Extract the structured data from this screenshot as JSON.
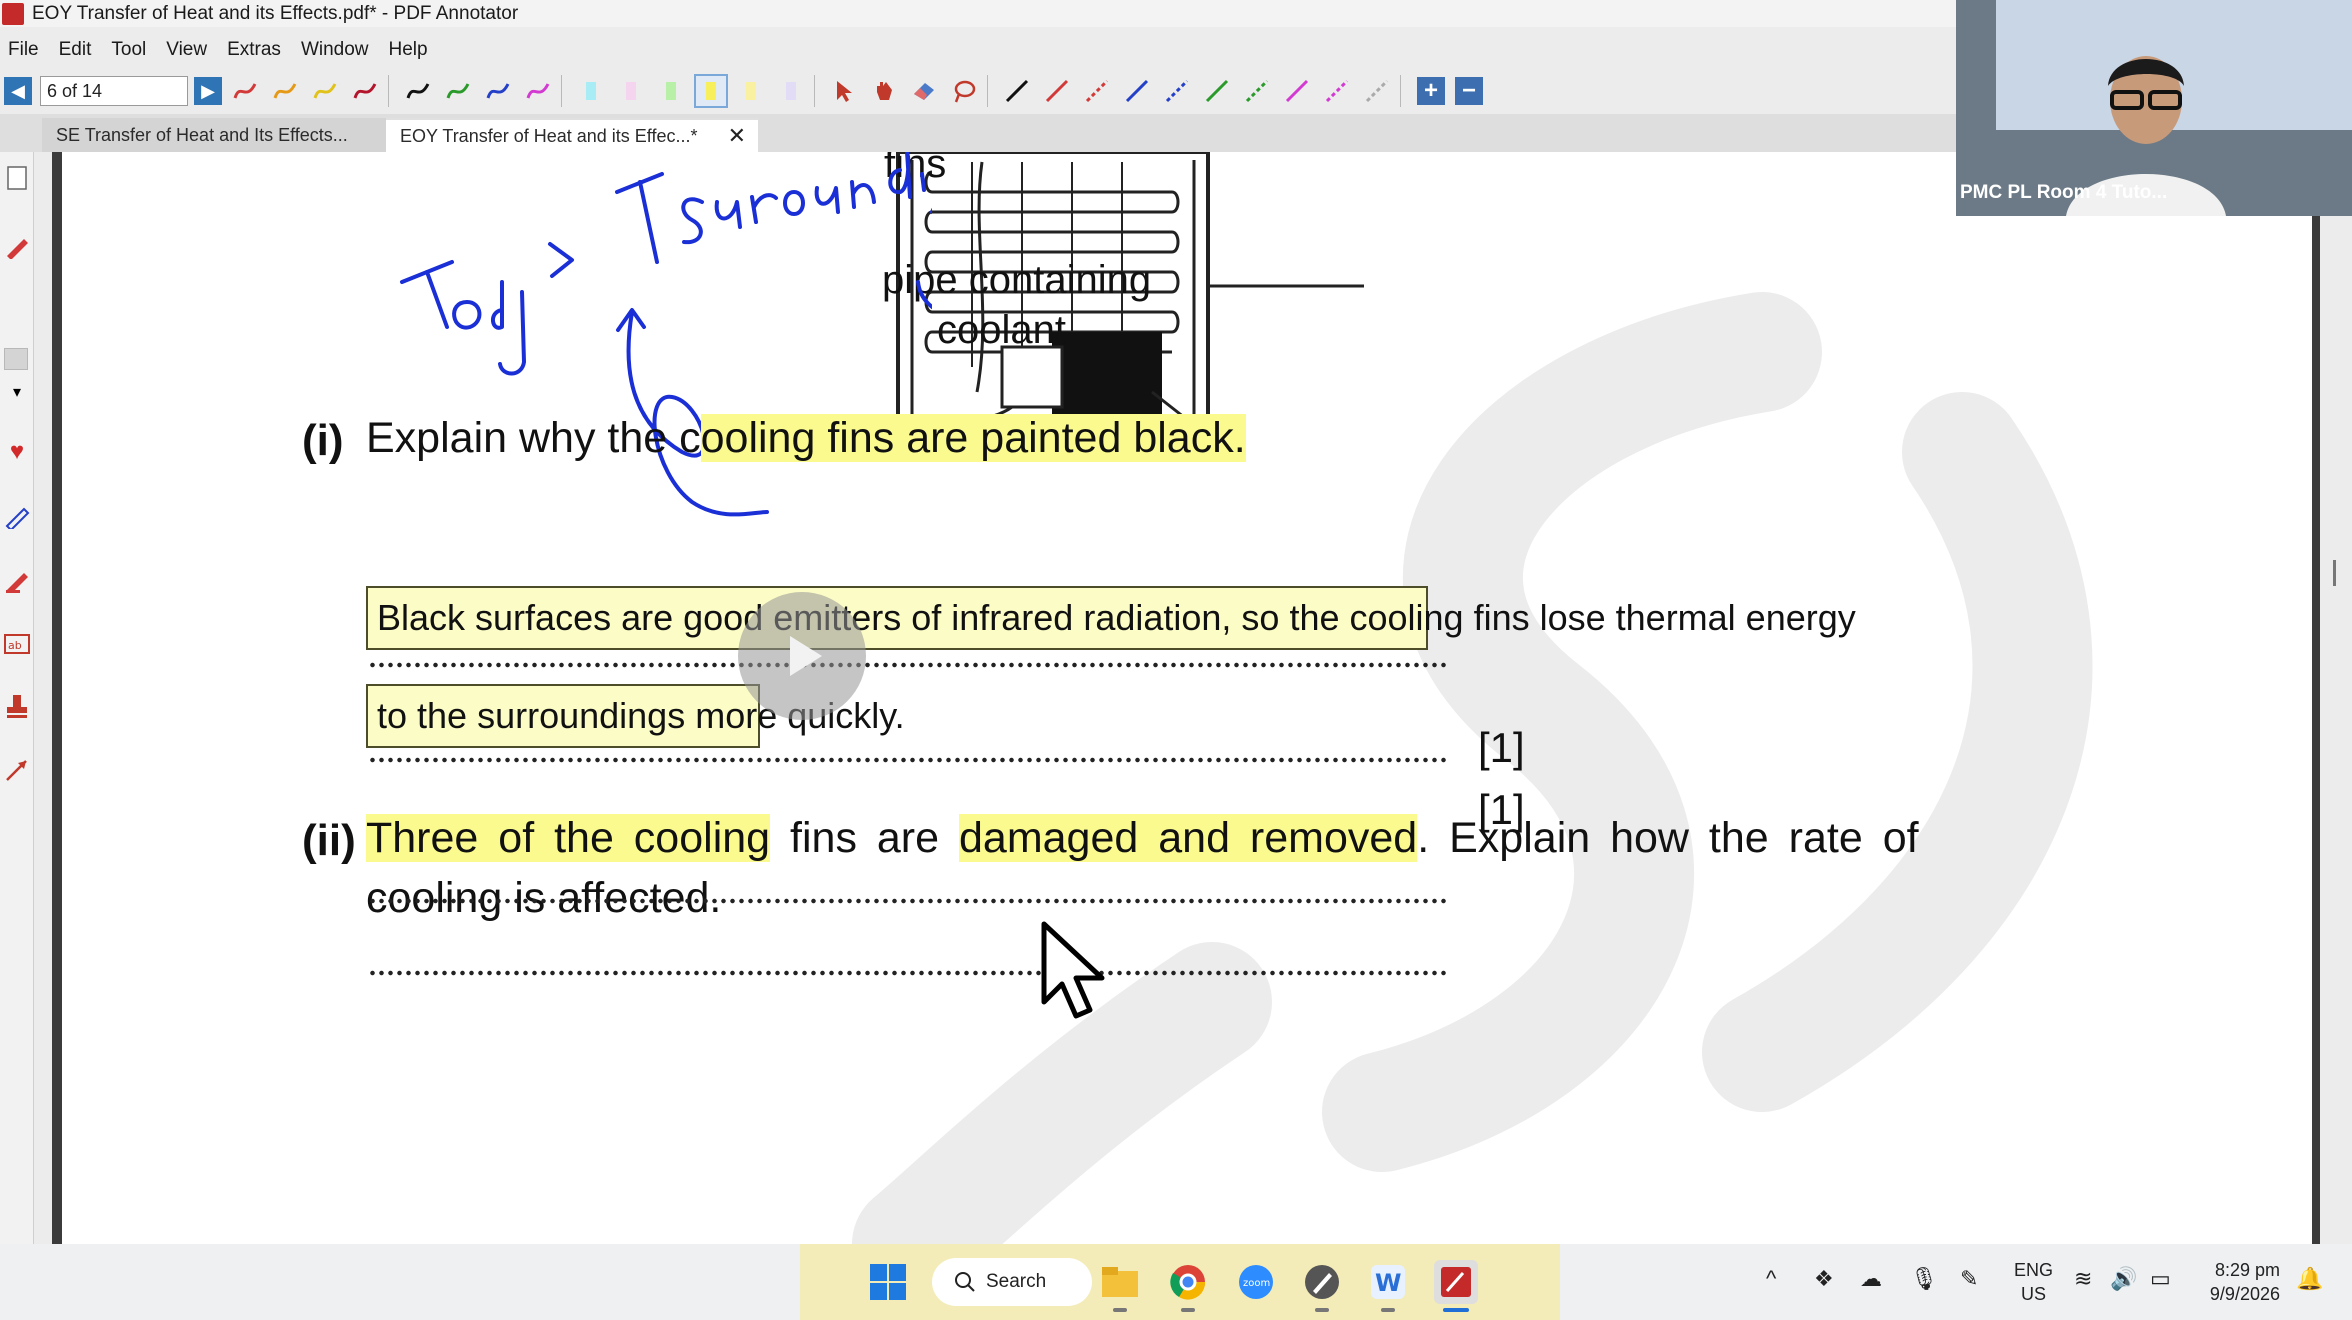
{
  "window": {
    "title": "EOY Transfer of Heat and its Effects.pdf* - PDF Annotator"
  },
  "menu": [
    "File",
    "Edit",
    "Tool",
    "View",
    "Extras",
    "Window",
    "Help"
  ],
  "toolbar": {
    "page_indicator": "6 of 14"
  },
  "tabs": [
    {
      "label": "SE Transfer of Heat and Its Effects..."
    },
    {
      "label": "EOY Transfer of Heat and its Effec...*"
    }
  ],
  "document": {
    "diagram_labels": {
      "fins": "fins",
      "pipe_line1": "pipe containing",
      "pipe_line2": "coolant"
    },
    "handwriting": {
      "text": "Tobj > Tsurrounding"
    },
    "q1": {
      "label": "(i)",
      "prefix": "Explain why the c",
      "highlight": "ooling fins are painted black.",
      "answer_line1": "Black surfaces are good emitters of infrared radiation, so the cooling fins lose thermal energy",
      "answer_line2": "to the surroundings more quickly.",
      "marks": "[1]"
    },
    "q2": {
      "label": "(ii)",
      "hl1": "Three of the cooling",
      "mid": " fins are ",
      "hl2": "damaged and removed",
      "rest": ". Explain how the rate of",
      "line2": "cooling is affected.",
      "marks": "[1]"
    }
  },
  "webcam": {
    "name": "PMC PL Room 4 Tuto..."
  },
  "taskbar": {
    "search_label": "Search",
    "lang": "ENG",
    "region": "US",
    "time": "8:29 pm",
    "date": "9/9/2026"
  },
  "colors": {
    "highlight": "#fafa8f",
    "ink_blue": "#1a2fd6",
    "answer_fill": "#fcfcc7",
    "accent": "#2f74b5"
  }
}
